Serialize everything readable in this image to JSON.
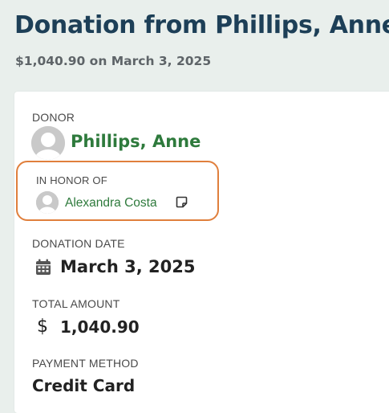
{
  "header": {
    "title": "Donation from Phillips, Anne",
    "subtitle": "$1,040.90 on March 3, 2025"
  },
  "donor": {
    "label": "DONOR",
    "name": "Phillips, Anne"
  },
  "honor": {
    "label": "IN HONOR OF",
    "name": "Alexandra Costa"
  },
  "donation_date": {
    "label": "DONATION DATE",
    "value": "March 3, 2025"
  },
  "total_amount": {
    "label": "TOTAL AMOUNT",
    "currency_symbol": "$",
    "value": "1,040.90"
  },
  "payment_method": {
    "label": "PAYMENT METHOD",
    "value": "Credit Card"
  },
  "colors": {
    "title": "#1d3f57",
    "link_green": "#2e7a3c",
    "highlight_orange": "#e07f3c",
    "background": "#e9efec"
  },
  "icons": {
    "donor_avatar": "avatar-icon",
    "honor_avatar": "avatar-icon",
    "note": "note-icon",
    "date": "calendar-icon",
    "amount": "dollar-icon"
  }
}
